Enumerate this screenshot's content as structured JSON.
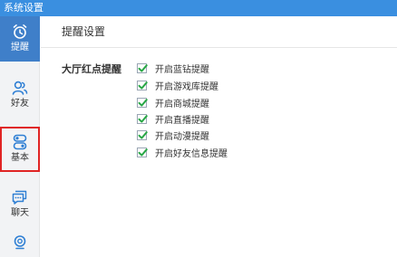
{
  "window": {
    "title": "系统设置"
  },
  "sidebar": {
    "items": [
      {
        "label": "提醒",
        "icon": "alarm-clock-icon",
        "active": true
      },
      {
        "label": "好友",
        "icon": "friends-icon",
        "active": false
      },
      {
        "label": "基本",
        "icon": "toggle-icon",
        "active": false,
        "highlighted": true
      },
      {
        "label": "聊天",
        "icon": "chat-icon",
        "active": false
      },
      {
        "label": "",
        "icon": "camera-icon",
        "active": false
      }
    ]
  },
  "main": {
    "title": "提醒设置",
    "section": {
      "label": "大厅红点提醒",
      "options": [
        {
          "label": "开启蓝钻提醒",
          "checked": true
        },
        {
          "label": "开启游戏库提醒",
          "checked": true
        },
        {
          "label": "开启商城提醒",
          "checked": true
        },
        {
          "label": "开启直播提醒",
          "checked": true
        },
        {
          "label": "开启动漫提醒",
          "checked": true
        },
        {
          "label": "开启好友信息提醒",
          "checked": true
        }
      ]
    }
  },
  "colors": {
    "titlebar": "#3a8fe0",
    "active_nav": "#3f7fc9",
    "checkmark": "#28a745",
    "highlight_border": "#e02424"
  }
}
